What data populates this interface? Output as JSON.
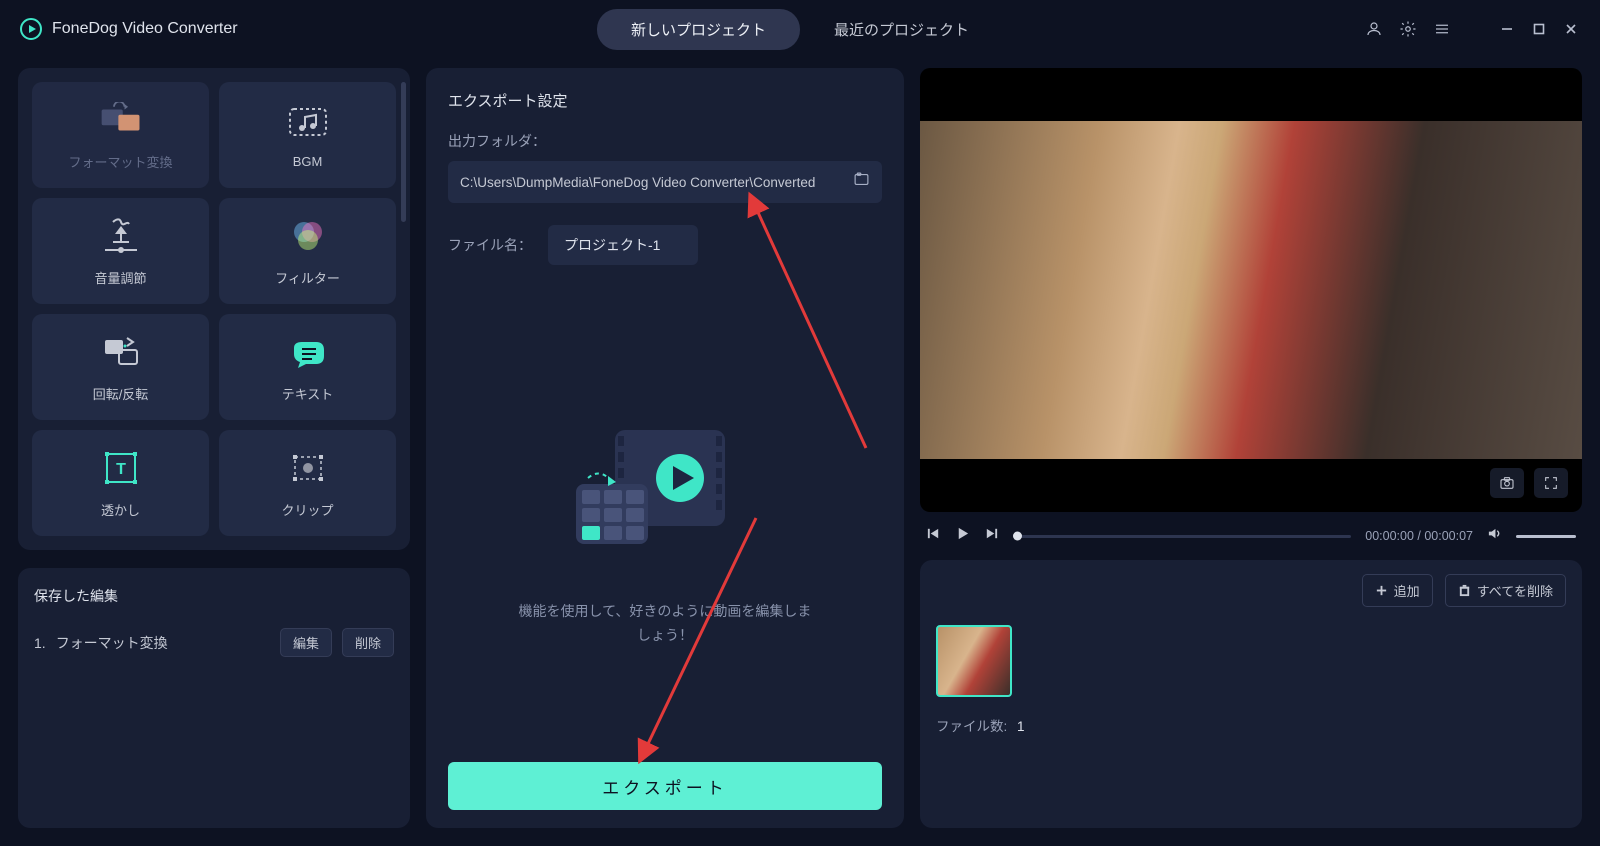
{
  "app": {
    "title": "FoneDog Video Converter"
  },
  "tabs": {
    "newProject": "新しいプロジェクト",
    "recent": "最近のプロジェクト"
  },
  "tools": {
    "format": "フォーマット変換",
    "bgm": "BGM",
    "volume": "音量調節",
    "filter": "フィルター",
    "rotate": "回転/反転",
    "text": "テキスト",
    "watermark": "透かし",
    "clip": "クリップ"
  },
  "saved": {
    "title": "保存した編集",
    "row1_index": "1.",
    "row1_name": "フォーマット変換",
    "editBtn": "編集",
    "deleteBtn": "削除"
  },
  "export": {
    "title": "エクスポート設定",
    "outputFolderLabel": "出力フォルダ：",
    "outputPath": "C:\\Users\\DumpMedia\\FoneDog Video Converter\\Converted",
    "fileNameLabel": "ファイル名：",
    "fileNameValue": "プロジェクト-1",
    "hint": "機能を使用して、好きのように動画を編集しま\nしょう！",
    "button": "エクスポート"
  },
  "player": {
    "time": "00:00:00 / 00:00:07"
  },
  "files": {
    "addBtn": "追加",
    "deleteAllBtn": "すべてを削除",
    "countLabel": "ファイル数:",
    "countValue": "1"
  }
}
